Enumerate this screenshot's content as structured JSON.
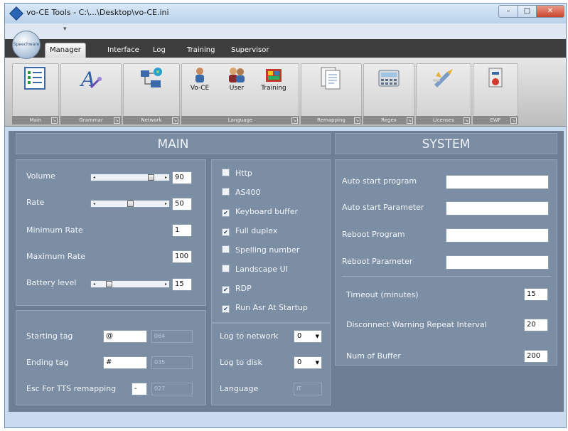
{
  "window": {
    "title": "vo-CE Tools - C:\\...\\Desktop\\vo-CE.ini",
    "controls": [
      "–",
      "□",
      "✕"
    ]
  },
  "orb_label": "Speechware",
  "tabs": [
    "Manager",
    "Interface",
    "Log",
    "Training",
    "Supervisor"
  ],
  "ribbon": {
    "groups": [
      {
        "label": "Main",
        "buttons": [
          {
            "label": "",
            "icon": "checklist-icon"
          }
        ]
      },
      {
        "label": "Grammar",
        "buttons": [
          {
            "label": "",
            "icon": "grammar-icon"
          }
        ]
      },
      {
        "label": "Network",
        "buttons": [
          {
            "label": "",
            "icon": "network-icon"
          }
        ]
      },
      {
        "label": "Language",
        "buttons": [
          {
            "label": "Vo-CE",
            "icon": "vo-ce-icon"
          },
          {
            "label": "User",
            "icon": "user-icon"
          },
          {
            "label": "Training",
            "icon": "training-icon"
          }
        ]
      },
      {
        "label": "Remapping",
        "buttons": [
          {
            "label": "",
            "icon": "documents-icon"
          }
        ]
      },
      {
        "label": "Regex",
        "buttons": [
          {
            "label": "",
            "icon": "calculator-icon"
          }
        ]
      },
      {
        "label": "Licenses",
        "buttons": [
          {
            "label": "",
            "icon": "license-icon"
          }
        ]
      },
      {
        "label": "EWF",
        "buttons": [
          {
            "label": "",
            "icon": "ewf-icon"
          }
        ]
      }
    ]
  },
  "main": {
    "title": "MAIN",
    "volume": {
      "label": "Volume",
      "value": "90",
      "level": 0.85
    },
    "rate": {
      "label": "Rate",
      "value": "50",
      "level": 0.5
    },
    "min_rate": {
      "label": "Minimum Rate",
      "value": "1"
    },
    "max_rate": {
      "label": "Maximum Rate",
      "value": "100"
    },
    "battery": {
      "label": "Battery level",
      "value": "15",
      "level": 0.15
    },
    "starting_tag": {
      "label": "Starting tag",
      "value": "@",
      "code": "064"
    },
    "ending_tag": {
      "label": "Ending tag",
      "value": "#",
      "code": "035"
    },
    "esc_tts": {
      "label": "Esc For TTS remapping",
      "value": "-",
      "code": "027"
    },
    "checkboxes": [
      {
        "label": "Http",
        "checked": false
      },
      {
        "label": "AS400",
        "checked": false
      },
      {
        "label": "Keyboard buffer",
        "checked": true
      },
      {
        "label": "Full duplex",
        "checked": true
      },
      {
        "label": "Spelling number",
        "checked": false
      },
      {
        "label": "Landscape UI",
        "checked": false
      },
      {
        "label": "RDP",
        "checked": true
      },
      {
        "label": "Run Asr At Startup",
        "checked": true
      }
    ],
    "log_network": {
      "label": "Log to network",
      "value": "0"
    },
    "log_disk": {
      "label": "Log to disk",
      "value": "0"
    },
    "language": {
      "label": "Language",
      "value": "IT"
    }
  },
  "system": {
    "title": "SYSTEM",
    "auto_start_program": {
      "label": "Auto start program",
      "value": ""
    },
    "auto_start_param": {
      "label": "Auto start Parameter",
      "value": ""
    },
    "reboot_program": {
      "label": "Reboot Program",
      "value": ""
    },
    "reboot_param": {
      "label": "Reboot Parameter",
      "value": ""
    },
    "timeout": {
      "label": "Timeout (minutes)",
      "value": "15"
    },
    "disconnect": {
      "label": "Disconnect Warning Repeat Interval",
      "value": "20"
    },
    "num_buffer": {
      "label": "Num of Buffer",
      "value": "200"
    }
  },
  "colors": {
    "accent": "#2a64b4",
    "panel": "#7b8ea3",
    "frame": "#c9dcef"
  }
}
